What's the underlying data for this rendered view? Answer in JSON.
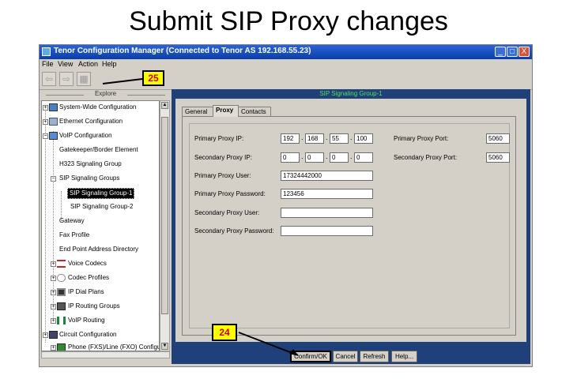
{
  "slide": {
    "title": "Submit SIP Proxy changes"
  },
  "window": {
    "title": "Tenor Configuration Manager (Connected to Tenor AS 192.168.55.23)",
    "controls": {
      "minimize": "_",
      "maximize": "□",
      "close": "X"
    }
  },
  "menu": {
    "file": "File",
    "view": "View",
    "action": "Action",
    "help": "Help"
  },
  "toolbar": {
    "back": "⇦",
    "forward": "⇨",
    "grid": "▦"
  },
  "callouts": {
    "toolbar": "25",
    "confirm": "24"
  },
  "explore": {
    "header": "Explore",
    "items": [
      {
        "label": "System-Wide Configuration"
      },
      {
        "label": "Ethernet Configuration"
      },
      {
        "label": "VoIP Configuration"
      },
      {
        "label": "Gatekeeper/Border Element"
      },
      {
        "label": "H323 Signaling Group"
      },
      {
        "label": "SIP Signaling Groups"
      },
      {
        "label": "SIP Signaling Group-1"
      },
      {
        "label": "SIP Signaling Group-2"
      },
      {
        "label": "Gateway"
      },
      {
        "label": "Fax Profile"
      },
      {
        "label": "End Point Address Directory"
      },
      {
        "label": "Voice Codecs"
      },
      {
        "label": "Codec Profiles"
      },
      {
        "label": "IP Dial Plans"
      },
      {
        "label": "IP Routing Groups"
      },
      {
        "label": "VoIP Routing"
      },
      {
        "label": "Circuit Configuration"
      },
      {
        "label": "Phone (FXS)/Line (FXO) Configur"
      }
    ]
  },
  "panel": {
    "header": "SIP Signaling Group-1",
    "tabs": {
      "general": "General",
      "proxy": "Proxy",
      "contacts": "Contacts"
    },
    "fields": {
      "primary_proxy_ip": {
        "label": "Primary Proxy IP:",
        "octets": [
          "192",
          "168",
          "55",
          "100"
        ]
      },
      "secondary_proxy_ip": {
        "label": "Secondary Proxy IP:",
        "octets": [
          "0",
          "0",
          "0",
          "0"
        ]
      },
      "primary_proxy_port": {
        "label": "Primary Proxy Port:",
        "value": "5060"
      },
      "secondary_proxy_port": {
        "label": "Secondary Proxy Port:",
        "value": "5060"
      },
      "primary_proxy_user": {
        "label": "Primary Proxy User:",
        "value": "17324442000"
      },
      "primary_proxy_password": {
        "label": "Primary Proxy Password:",
        "value": "123456"
      },
      "secondary_proxy_user": {
        "label": "Secondary Proxy User:",
        "value": ""
      },
      "secondary_proxy_password": {
        "label": "Secondary Proxy Password:",
        "value": ""
      }
    },
    "ip_separator": "."
  },
  "buttons": {
    "confirm": "Confirm/OK",
    "cancel": "Cancel",
    "refresh": "Refresh",
    "help": "Help..."
  },
  "colors": {
    "titlebar": "#0a3ea8",
    "panel_bg": "#20407a",
    "panel_header_text": "#54e054",
    "callout_bg": "#ffff00",
    "callout_text": "#cc0000"
  }
}
